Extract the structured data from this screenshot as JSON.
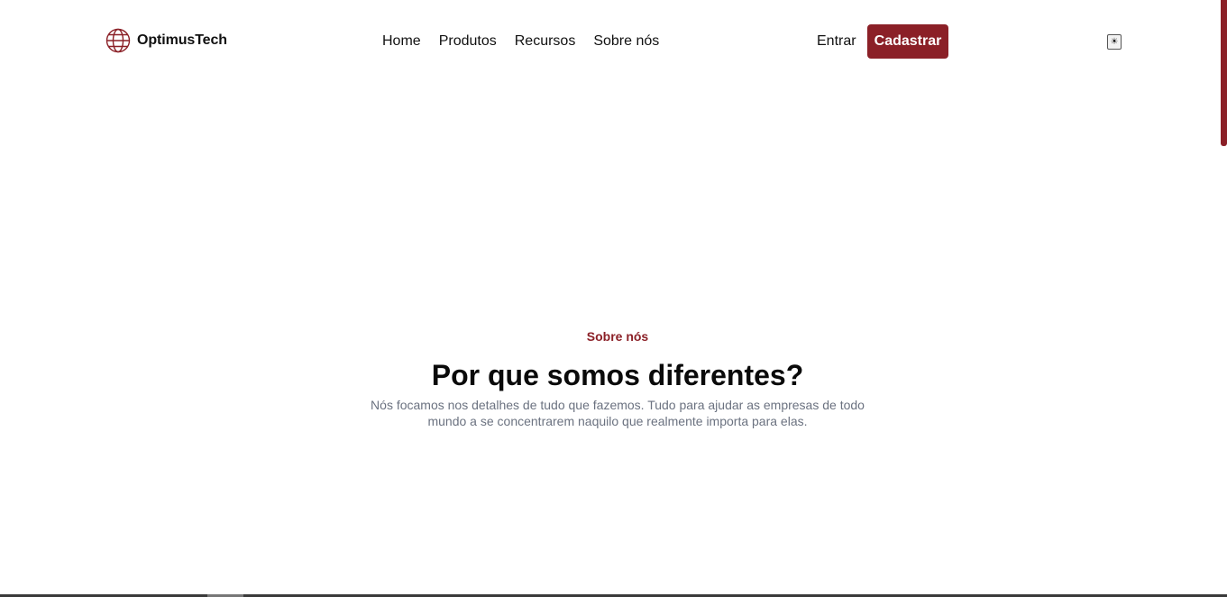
{
  "header": {
    "brand": "OptimusTech",
    "nav": [
      {
        "label": "Home"
      },
      {
        "label": "Produtos"
      },
      {
        "label": "Recursos"
      },
      {
        "label": "Sobre nós"
      }
    ],
    "signin_label": "Entrar",
    "signup_label": "Cadastrar",
    "theme_toggle_icon": "sun-icon",
    "theme_toggle_glyph": "☀"
  },
  "about": {
    "eyebrow": "Sobre nós",
    "title": "Por que somos diferentes?",
    "description": "Nós focamos nos detalhes de tudo que fazemos. Tudo para ajudar as empresas de todo mundo a se concentrarem naquilo que realmente importa para elas."
  },
  "colors": {
    "accent": "#8b2027",
    "text": "#111111",
    "muted": "#6b7280",
    "background": "#ffffff"
  }
}
